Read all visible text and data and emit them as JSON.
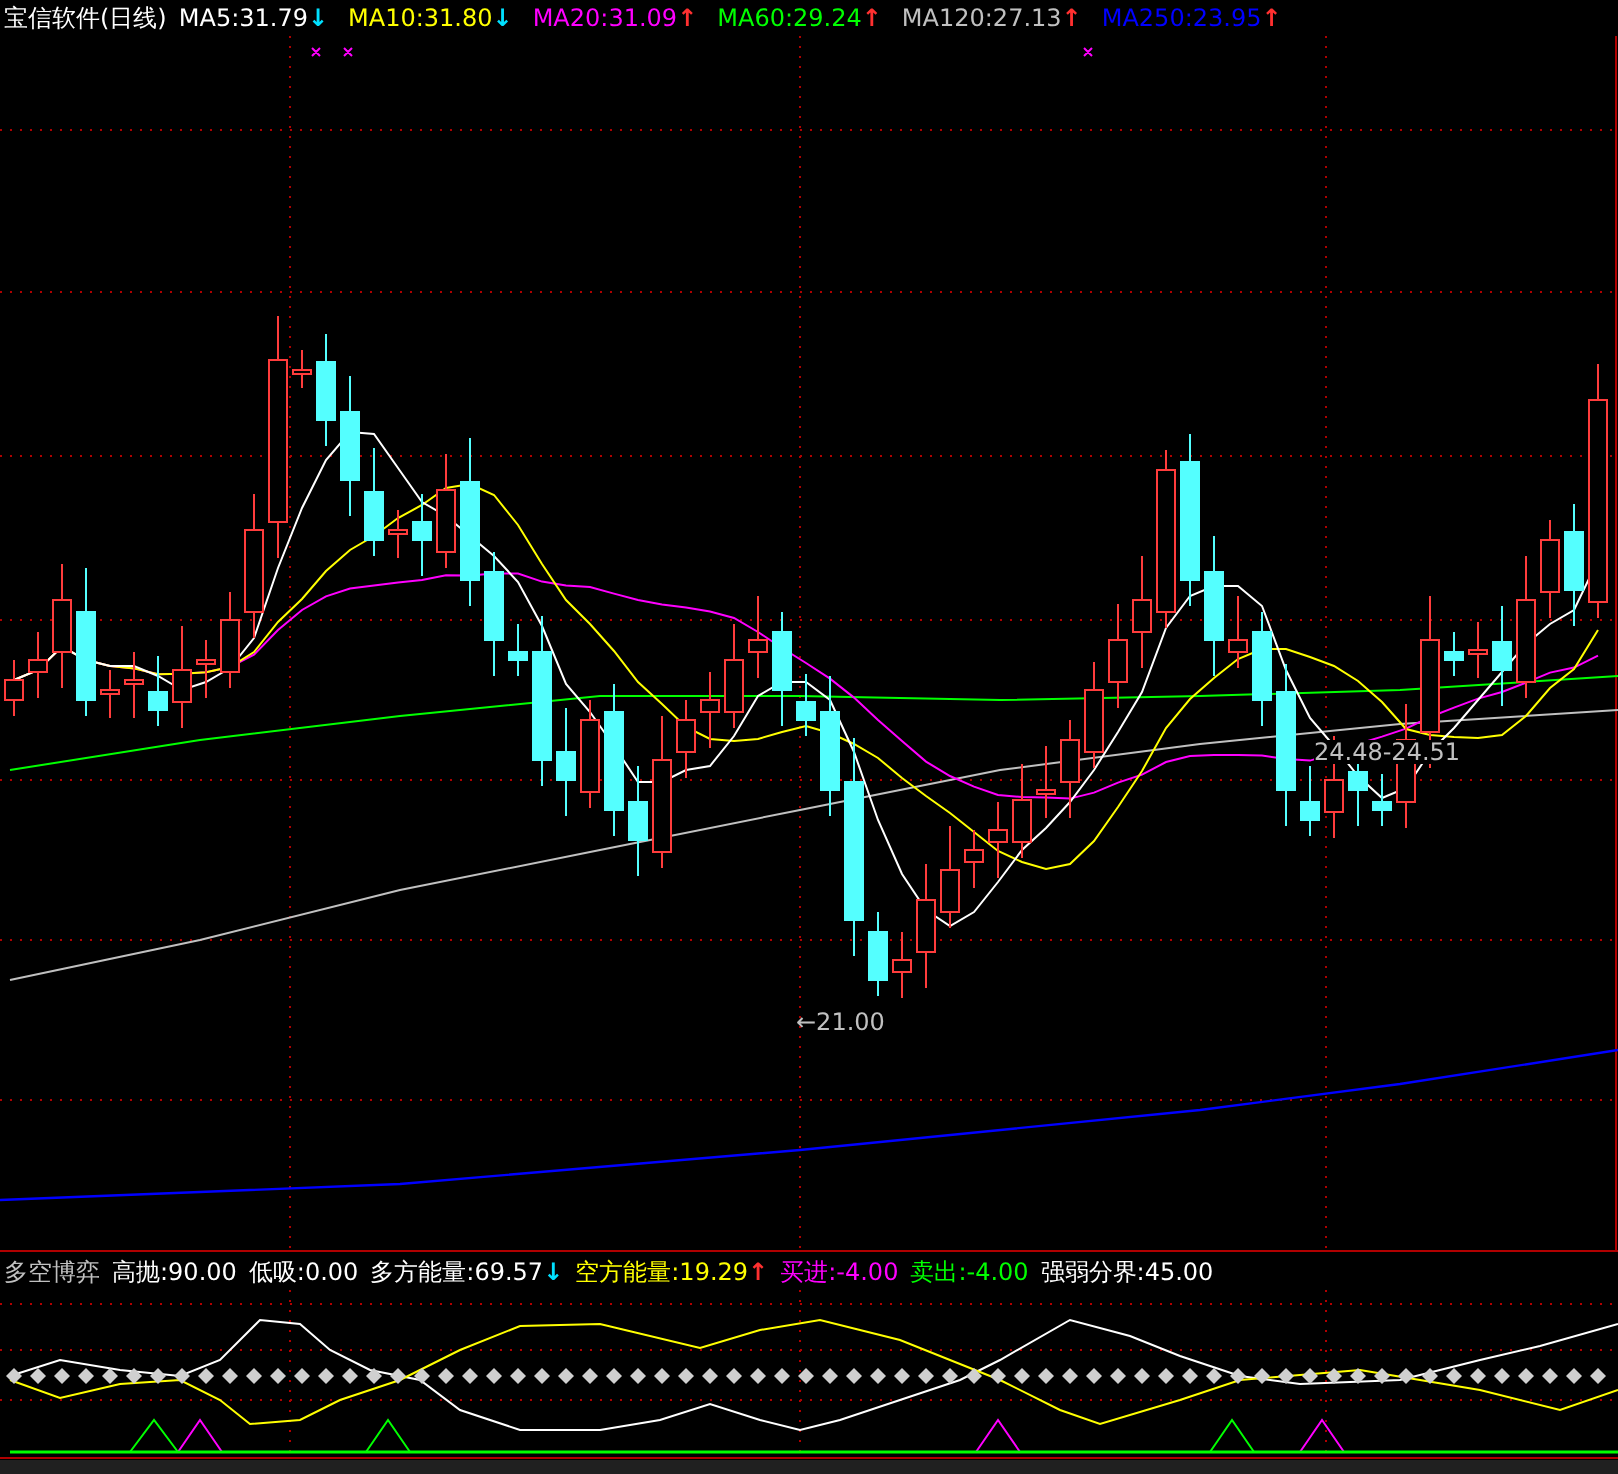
{
  "title": "宝信软件(日线)",
  "ma": [
    {
      "label": "MA5:31.79",
      "color": "#ffffff",
      "arrow": "↓",
      "rising": false
    },
    {
      "label": "MA10:31.80",
      "color": "#ffff00",
      "arrow": "↓",
      "rising": false
    },
    {
      "label": "MA20:31.09",
      "color": "#ff00ff",
      "arrow": "↑",
      "rising": true
    },
    {
      "label": "MA60:29.24",
      "color": "#00ff00",
      "arrow": "↑",
      "rising": true
    },
    {
      "label": "MA120:27.13",
      "color": "#c0c0c0",
      "arrow": "↑",
      "rising": true
    },
    {
      "label": "MA250:23.95",
      "color": "#0000ff",
      "arrow": "↑",
      "rising": true
    }
  ],
  "annotations": [
    {
      "text": "←21.00"
    },
    {
      "text": "24.48-24.51"
    }
  ],
  "indicator": {
    "name": "多空博弈",
    "items": [
      {
        "label": "高抛:90.00",
        "color": "#ffffff"
      },
      {
        "label": "低吸:0.00",
        "color": "#ffffff"
      },
      {
        "label": "多方能量:69.57",
        "color": "#ffffff",
        "arrow": "↓",
        "rising": false
      },
      {
        "label": "空方能量:19.29",
        "color": "#ffff00",
        "arrow": "↑",
        "rising": true
      },
      {
        "label": "买进:-4.00",
        "color": "#ff00ff"
      },
      {
        "label": "卖出:-4.00",
        "color": "#00ff00"
      },
      {
        "label": "强弱分界:45.00",
        "color": "#ffffff"
      }
    ]
  }
}
